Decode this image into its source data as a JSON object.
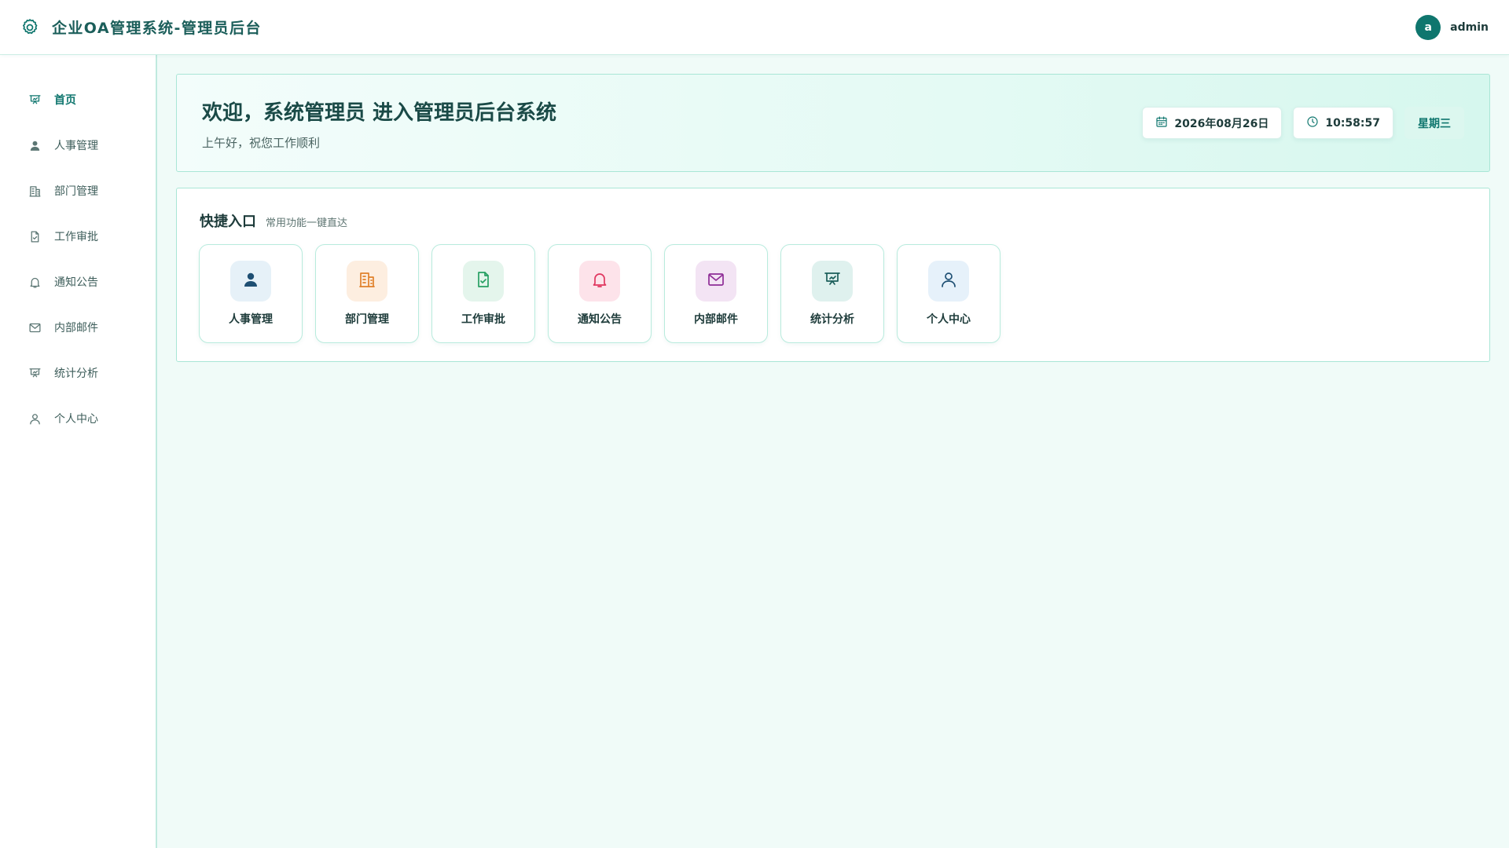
{
  "app": {
    "title": "企业OA管理系统-管理员后台"
  },
  "user": {
    "avatar_letter": "a",
    "name": "admin"
  },
  "sidebar": {
    "items": [
      {
        "label": "首页",
        "icon": "presentation-chart-icon",
        "active": true
      },
      {
        "label": "人事管理",
        "icon": "user-filled-icon",
        "active": false
      },
      {
        "label": "部门管理",
        "icon": "building-icon",
        "active": false
      },
      {
        "label": "工作审批",
        "icon": "document-check-icon",
        "active": false
      },
      {
        "label": "通知公告",
        "icon": "bell-icon",
        "active": false
      },
      {
        "label": "内部邮件",
        "icon": "mail-icon",
        "active": false
      },
      {
        "label": "统计分析",
        "icon": "presentation-chart-icon",
        "active": false
      },
      {
        "label": "个人中心",
        "icon": "user-outline-icon",
        "active": false
      }
    ]
  },
  "welcome": {
    "title": "欢迎，系统管理员 进入管理员后台系统",
    "subtitle": "上午好，祝您工作顺利",
    "date": "2026年08月26日",
    "time": "10:58:57",
    "weekday": "星期三"
  },
  "quick": {
    "title": "快捷入口",
    "subtitle": "常用功能一键直达",
    "items": [
      {
        "label": "人事管理",
        "icon": "user-filled-icon",
        "bg": "#e6f1f8",
        "color": "#1e4f73"
      },
      {
        "label": "部门管理",
        "icon": "building-icon",
        "bg": "#fdeee0",
        "color": "#e0802a"
      },
      {
        "label": "工作审批",
        "icon": "document-check-icon",
        "bg": "#e4f5ec",
        "color": "#27a063"
      },
      {
        "label": "通知公告",
        "icon": "bell-icon",
        "bg": "#fde3ea",
        "color": "#e0365f"
      },
      {
        "label": "内部邮件",
        "icon": "mail-icon",
        "bg": "#f3e4f4",
        "color": "#8e2c96"
      },
      {
        "label": "统计分析",
        "icon": "presentation-chart-icon",
        "bg": "#dff1ee",
        "color": "#1b5e5a"
      },
      {
        "label": "个人中心",
        "icon": "user-outline-icon",
        "bg": "#e6f1fa",
        "color": "#1e4f73"
      }
    ]
  },
  "colors": {
    "accent": "#0f766e",
    "border": "#a9e6d6",
    "background": "#f0fbf8"
  }
}
